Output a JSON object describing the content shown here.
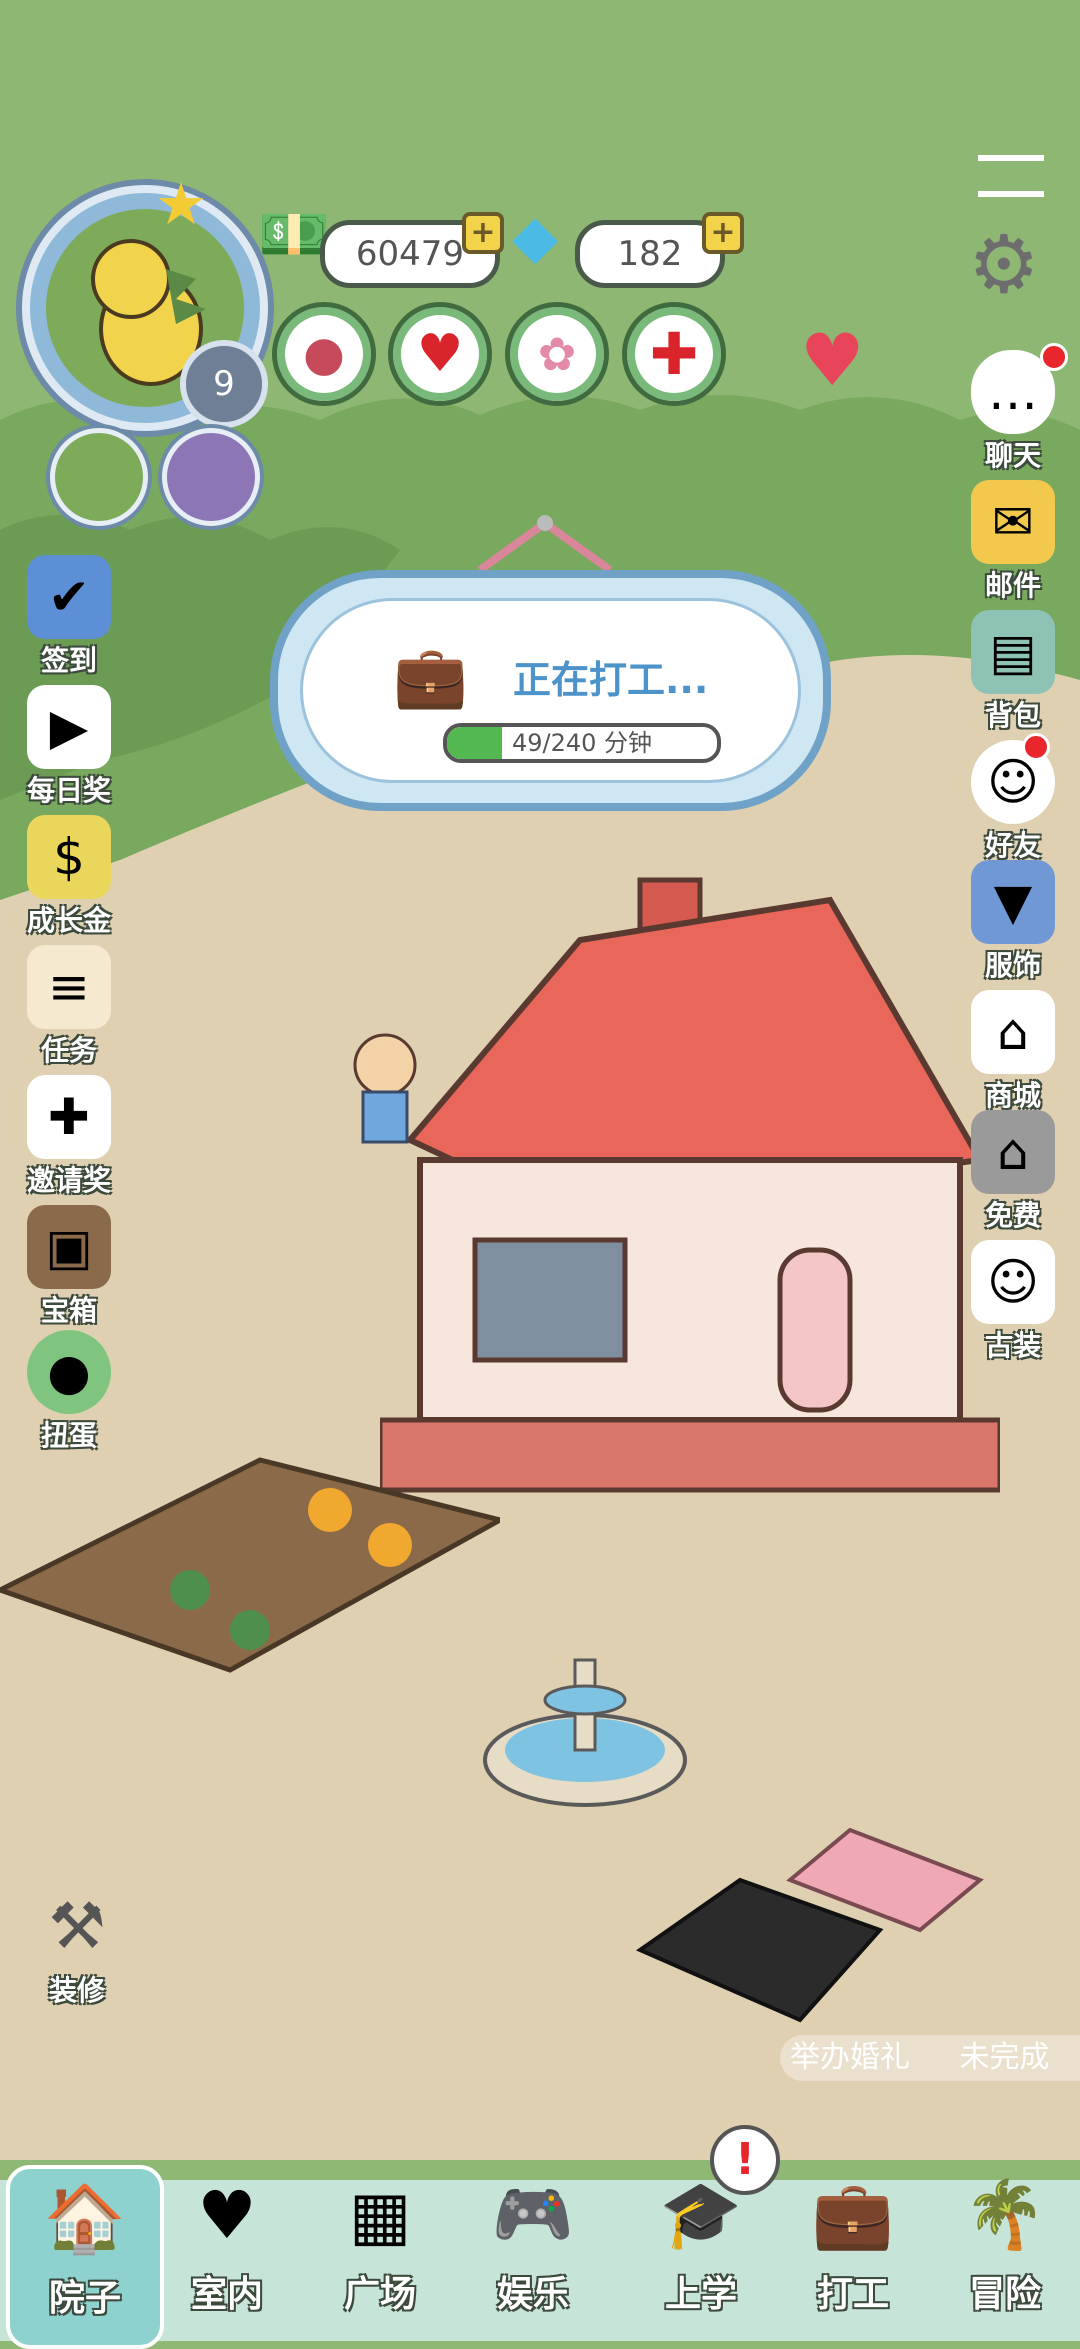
{
  "currency": {
    "cash": "60479",
    "diamonds": "182"
  },
  "player": {
    "level": "9"
  },
  "work": {
    "title": "正在打工...",
    "progress_text": "49/240 分钟",
    "progress_fraction": 0.204
  },
  "left_menu": [
    {
      "label": "签到",
      "icon": "calendar-check-icon"
    },
    {
      "label": "每日奖",
      "icon": "video-reward-icon"
    },
    {
      "label": "成长金",
      "icon": "money-bag-icon"
    },
    {
      "label": "任务",
      "icon": "task-list-icon"
    },
    {
      "label": "邀请奖",
      "icon": "invite-icon"
    },
    {
      "label": "宝箱",
      "icon": "treasure-chest-icon"
    },
    {
      "label": "扭蛋",
      "icon": "gacha-icon"
    }
  ],
  "right_menu": [
    {
      "label": "聊天",
      "icon": "chat-icon"
    },
    {
      "label": "邮件",
      "icon": "mail-icon"
    },
    {
      "label": "背包",
      "icon": "backpack-icon"
    },
    {
      "label": "好友",
      "icon": "friends-icon"
    },
    {
      "label": "服饰",
      "icon": "clothes-icon"
    },
    {
      "label": "商城",
      "icon": "shop-icon"
    },
    {
      "label": "免费",
      "icon": "house-icon"
    },
    {
      "label": "古装",
      "icon": "costume-icon"
    }
  ],
  "renovate": {
    "label": "装修"
  },
  "wedding_hint": {
    "text": "举办婚礼",
    "status": "未完成"
  },
  "nav": [
    {
      "label": "院子"
    },
    {
      "label": "室内"
    },
    {
      "label": "广场"
    },
    {
      "label": "娱乐"
    },
    {
      "label": "上学"
    },
    {
      "label": "打工"
    },
    {
      "label": "冒险"
    }
  ],
  "colors": {
    "accent": "#53b84f",
    "sky": "#8db773",
    "ground": "#dfd0b2",
    "roof": "#e8665a"
  }
}
